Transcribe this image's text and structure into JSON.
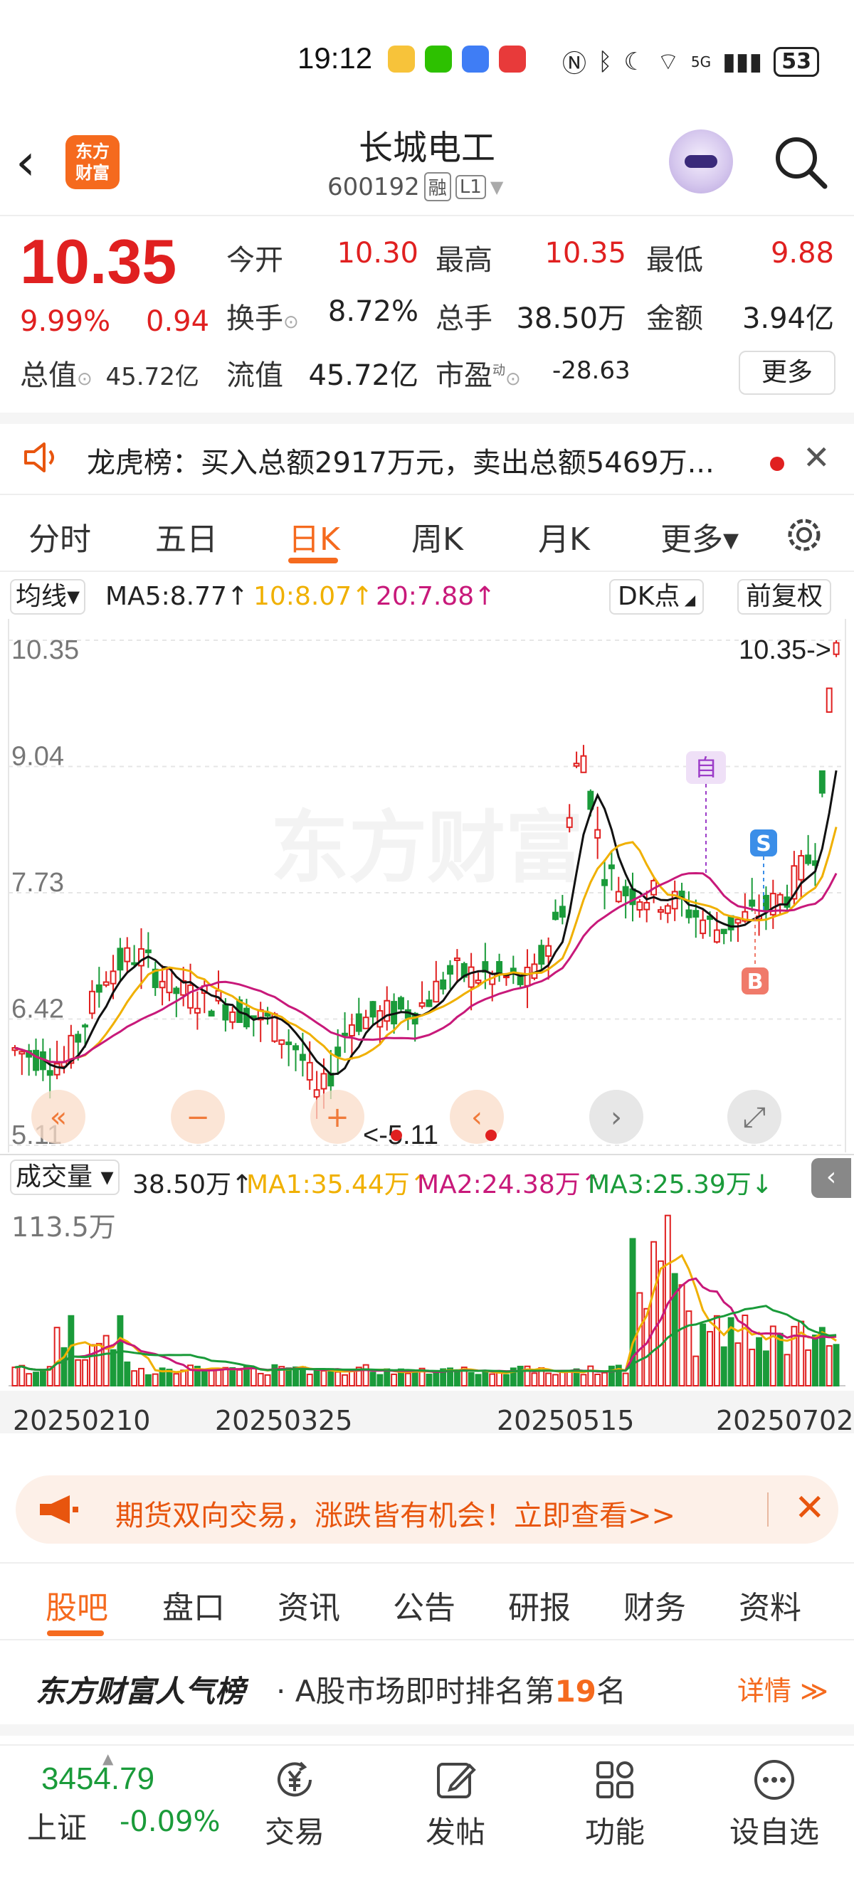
{
  "status_bar": {
    "time": "19:12",
    "network": "5G",
    "battery": "53",
    "apps": [
      "weibo-app",
      "wechat-app",
      "lark-app",
      "video-app"
    ]
  },
  "header": {
    "back_icon": "chevron-left-icon",
    "logo_text": "东方\n财富",
    "stock_name": "长城电工",
    "stock_code": "600192",
    "tag_rong": "融",
    "tag_level": "L1",
    "avatar_icon": "robot-icon",
    "search_icon": "search-icon"
  },
  "quote": {
    "price": "10.35",
    "change_pct": "9.99%",
    "change_amt": "0.94",
    "total_value_label": "总值",
    "total_value": "45.72亿",
    "fields": [
      {
        "label": "今开",
        "value": "10.30",
        "color": "#e02020"
      },
      {
        "label": "最高",
        "value": "10.35",
        "color": "#e02020"
      },
      {
        "label": "最低",
        "value": "9.88",
        "color": "#e02020"
      },
      {
        "label": "换手",
        "value": "8.72%",
        "color": "#222222"
      },
      {
        "label": "总手",
        "value": "38.50万",
        "color": "#222222"
      },
      {
        "label": "金额",
        "value": "3.94亿",
        "color": "#222222"
      },
      {
        "label": "流值",
        "value": "45.72亿",
        "color": "#222222"
      },
      {
        "label": "市盈",
        "value": "-28.63",
        "color": "#222222"
      }
    ],
    "pe_superscript": "动",
    "more_label": "更多"
  },
  "notice": {
    "icon": "speaker-icon",
    "text": "龙虎榜：买入总额2917万元，卖出总额5469万...",
    "close_icon": "close-icon"
  },
  "chart_tabs": {
    "items": [
      "分时",
      "五日",
      "日K",
      "周K",
      "月K",
      "更多▾"
    ],
    "active_index": 2,
    "settings_icon": "gear-icon"
  },
  "ma_bar": {
    "dropdown": "均线▾",
    "ma5": "MA5:8.77↑",
    "ma10": "10:8.07↑",
    "ma20": "20:7.88↑",
    "dk_label": "DK点",
    "fq_label": "前复权",
    "colors": {
      "ma5": "#111111",
      "ma10": "#f0b000",
      "ma20": "#c8197a"
    }
  },
  "kline": {
    "y_labels": [
      "10.35",
      "9.04",
      "7.73",
      "6.42",
      "5.11"
    ],
    "max_label": "10.35->",
    "min_label": "<-5.11",
    "watermark": "东方财富",
    "marker_self": "自",
    "marker_sell": "S",
    "marker_buy": "B",
    "controls": [
      "double-chevron-left-icon",
      "minus-icon",
      "plus-icon",
      "chevron-left-icon",
      "chevron-right-icon",
      "expand-icon"
    ]
  },
  "volume_bar": {
    "dropdown": "成交量 ▾",
    "volume": "38.50万↑",
    "ma1": "MA1:35.44万↑",
    "ma2": "MA2:24.38万↑",
    "ma3": "MA3:25.39万↓",
    "max_label": "113.5万",
    "collapse_icon": "chevron-left-icon"
  },
  "dates": [
    "20250210",
    "20250325",
    "20250515",
    "20250702"
  ],
  "chart_data": [
    {
      "type": "candlestick",
      "y_ticks": [
        10.35,
        9.04,
        7.73,
        6.42,
        5.11
      ],
      "ylim": [
        5.11,
        10.35
      ],
      "x_tick_labels": [
        "20250210",
        "20250325",
        "20250515",
        "20250702"
      ],
      "series": [
        {
          "name": "MA5",
          "latest": 8.77
        },
        {
          "name": "MA10",
          "latest": 8.07
        },
        {
          "name": "MA20",
          "latest": 7.88
        }
      ],
      "period_high": 10.35,
      "period_low": 5.11
    },
    {
      "type": "bar",
      "y_max_label": "113.5万",
      "series": [
        {
          "name": "MA1",
          "latest": "35.44万"
        },
        {
          "name": "MA2",
          "latest": "24.38万"
        },
        {
          "name": "MA3",
          "latest": "25.39万"
        }
      ],
      "latest_volume": "38.50万"
    }
  ],
  "ad": {
    "icon": "megaphone-icon",
    "text": "期货双向交易，涨跌皆有机会！立即查看>>",
    "close_icon": "close-icon"
  },
  "sub_tabs": {
    "items": [
      "股吧",
      "盘口",
      "资讯",
      "公告",
      "研报",
      "财务",
      "资料"
    ],
    "active_index": 0
  },
  "rank": {
    "brand": "东方财富人气榜",
    "text_prefix": "· A股市场即时排名第",
    "rank_num": "19",
    "text_suffix": "名",
    "link": "详情 ≫"
  },
  "bottom_nav": {
    "index_value": "3454.79",
    "index_name": "上证",
    "index_pct": "-0.09%",
    "items": [
      {
        "label": "交易",
        "icon": "yen-cycle-icon"
      },
      {
        "label": "发帖",
        "icon": "edit-icon"
      },
      {
        "label": "功能",
        "icon": "grid-icon"
      },
      {
        "label": "设自选",
        "icon": "more-dots-icon"
      }
    ]
  }
}
